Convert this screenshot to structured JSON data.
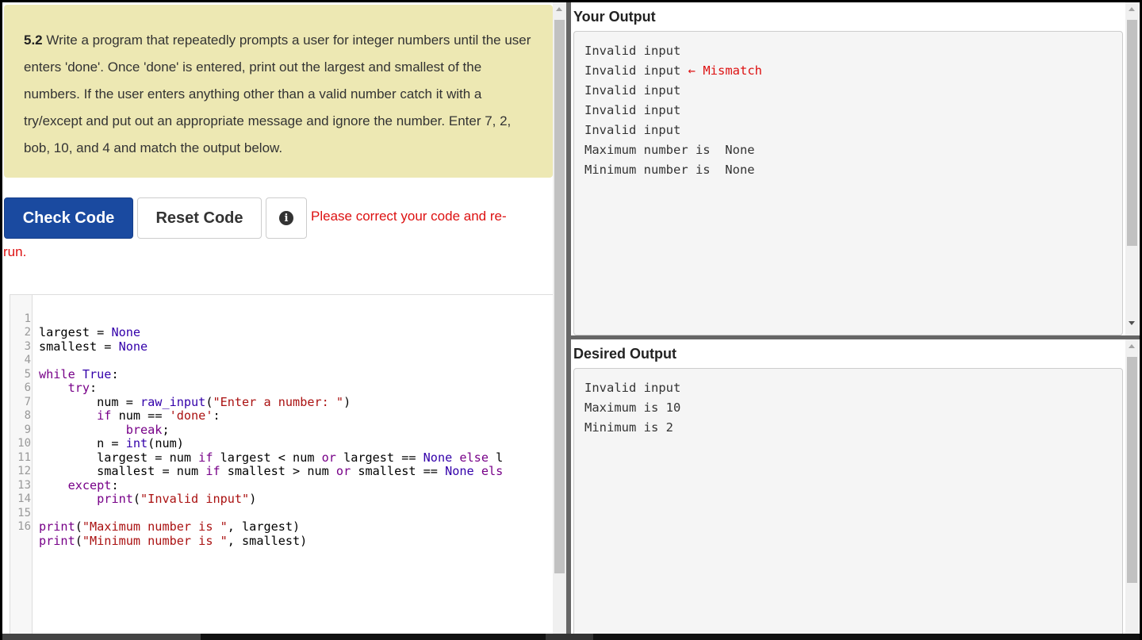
{
  "problem": {
    "number": "5.2",
    "text": " Write a program that repeatedly prompts a user for integer numbers until the user enters 'done'. Once 'done' is entered, print out the largest and smallest of the numbers. If the user enters anything other than a valid number catch it with a try/except and put out an appropriate message and ignore the number. Enter 7, 2, bob, 10, and 4 and match the output below."
  },
  "toolbar": {
    "check_label": "Check Code",
    "reset_label": "Reset Code",
    "info_icon": "i",
    "error_part1": "Please correct your code and re-",
    "error_part2": "run."
  },
  "code": {
    "line_numbers": [
      "1",
      "2",
      "3",
      "4",
      "5",
      "6",
      "7",
      "8",
      "9",
      "10",
      "11",
      "12",
      "13",
      "14",
      "15",
      "16"
    ]
  },
  "your_output": {
    "title": "Your Output",
    "lines": [
      "Invalid input",
      "Invalid input",
      "Invalid input",
      "Invalid input",
      "Invalid input",
      "Maximum number is  None",
      "Minimum number is  None"
    ],
    "mismatch_label": "← Mismatch"
  },
  "desired_output": {
    "title": "Desired Output",
    "lines": [
      "Invalid input",
      "Maximum is 10",
      "Minimum is 2"
    ]
  },
  "colors": {
    "check_button": "#1a4aa0",
    "problem_bg": "#ede8b3",
    "error_text": "#dd1111",
    "keyword": "#770088",
    "string": "#aa1111"
  }
}
